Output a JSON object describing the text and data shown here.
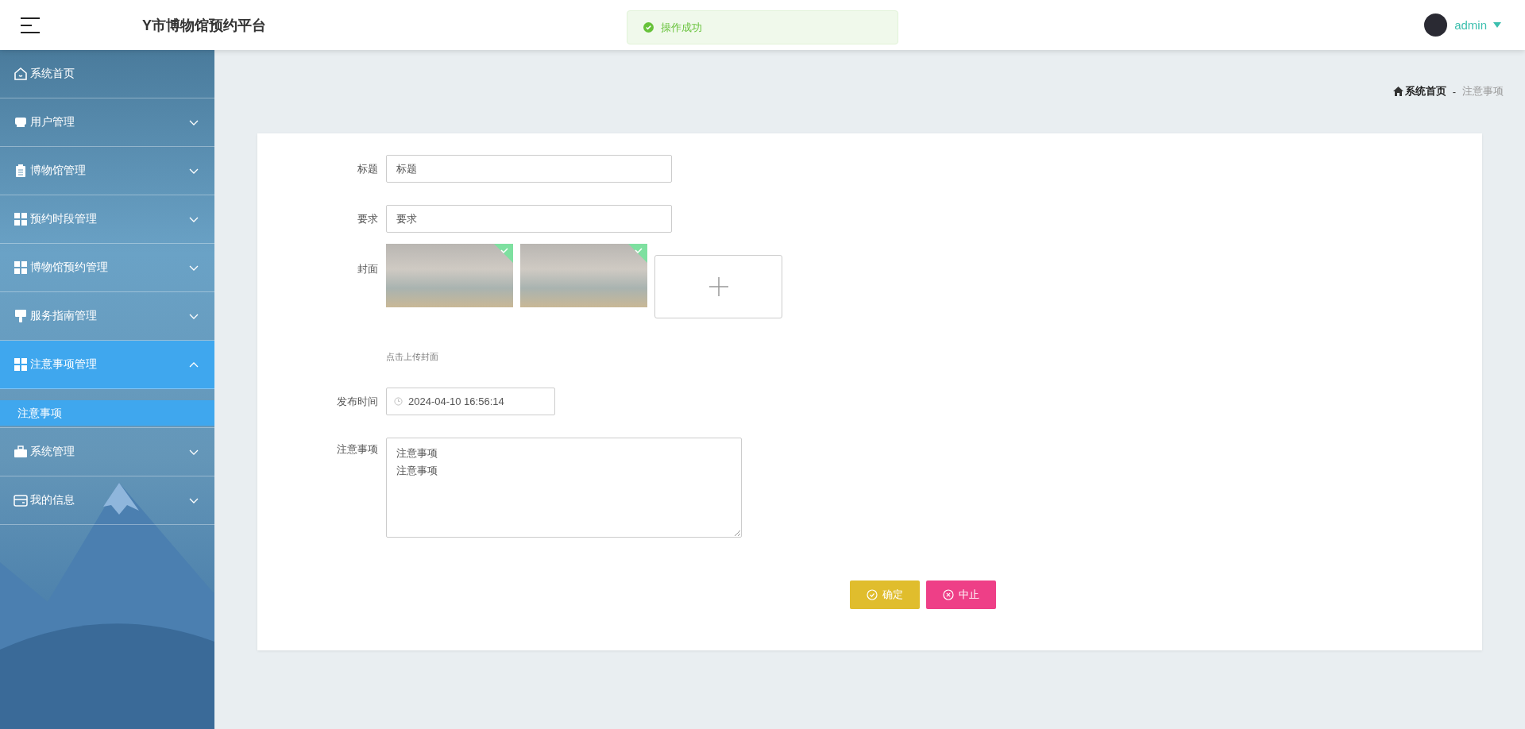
{
  "header": {
    "title": "Y市博物馆预约平台"
  },
  "toast": {
    "kind": "success",
    "text": "操作成功"
  },
  "user": {
    "name": "admin"
  },
  "sidebar": {
    "items": [
      {
        "label": "系统首页",
        "selected": false
      },
      {
        "label": "用户管理",
        "selected": false,
        "expanded": false
      },
      {
        "label": "博物馆管理",
        "selected": false,
        "expanded": false
      },
      {
        "label": "预约时段管理",
        "selected": false,
        "expanded": false
      },
      {
        "label": "博物馆预约管理",
        "selected": false,
        "expanded": false
      },
      {
        "label": "服务指南管理",
        "selected": false,
        "expanded": false
      },
      {
        "label": "注意事项管理",
        "selected": true,
        "expanded": true,
        "children": [
          {
            "label": "注意事项",
            "selected": true
          }
        ]
      },
      {
        "label": "系统管理",
        "selected": false,
        "expanded": false
      },
      {
        "label": "我的信息",
        "selected": false,
        "expanded": false
      }
    ]
  },
  "breadcrumb": {
    "separator": "-",
    "items": [
      {
        "label": "系统首页"
      },
      {
        "label": "注意事项"
      }
    ]
  },
  "form": {
    "fields": [
      {
        "kind": "text",
        "label": "标题",
        "value": "标题"
      },
      {
        "kind": "text",
        "label": "要求",
        "value": "要求"
      },
      {
        "kind": "upload",
        "label": "封面",
        "images": [
          {
            "uploaded": true
          },
          {
            "uploaded": true
          }
        ],
        "hint": "点击上传封面"
      },
      {
        "kind": "datetime",
        "label": "发布时间",
        "value": "2024-04-10 16:56:14"
      },
      {
        "kind": "textarea",
        "label": "注意事项",
        "lines": [
          "注意事项",
          "注意事项"
        ]
      }
    ],
    "buttons": [
      {
        "kind": "confirm",
        "label": "确定"
      },
      {
        "kind": "cancel",
        "label": "中止"
      }
    ]
  }
}
